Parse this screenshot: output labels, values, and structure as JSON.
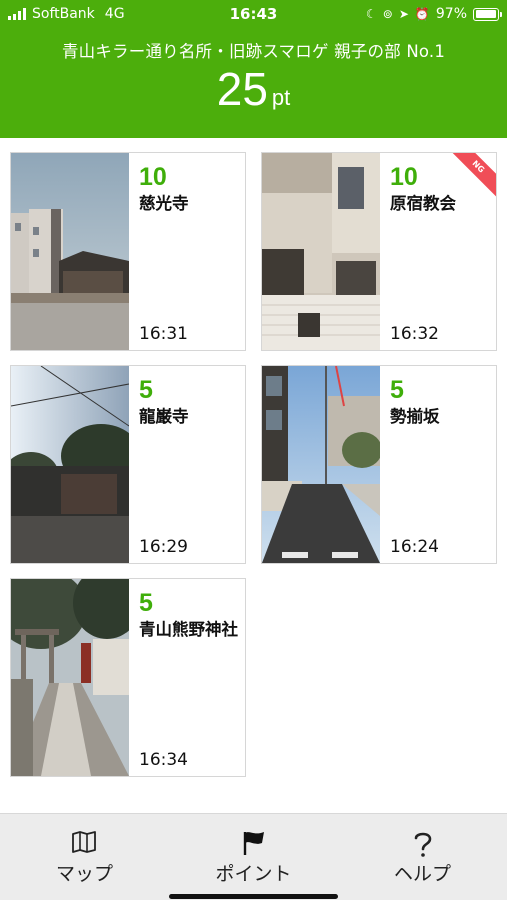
{
  "status_bar": {
    "carrier": "SoftBank",
    "network": "4G",
    "time": "16:43",
    "battery": "97%",
    "battery_level": 0.97,
    "icons": [
      "moon-icon",
      "rotation-lock-icon",
      "location-arrow-icon",
      "alarm-icon"
    ]
  },
  "header": {
    "title": "青山キラー通り名所・旧跡スマロゲ 親子の部 No.1",
    "score": "25",
    "score_unit": "pt",
    "background": "#4cae0c"
  },
  "cards": [
    {
      "points": "10",
      "name": "慈光寺",
      "time": "16:31",
      "ng": ""
    },
    {
      "points": "10",
      "name": "原宿教会",
      "time": "16:32",
      "ng": "NG"
    },
    {
      "points": "5",
      "name": "龍巌寺",
      "time": "16:29",
      "ng": ""
    },
    {
      "points": "5",
      "name": "勢揃坂",
      "time": "16:24",
      "ng": ""
    },
    {
      "points": "5",
      "name": "青山熊野神社",
      "time": "16:34",
      "ng": ""
    }
  ],
  "points_color": "#3fae0a",
  "ng_color": "#f04d57",
  "tabs": [
    {
      "label": "マップ",
      "icon": "map-icon"
    },
    {
      "label": "ポイント",
      "icon": "flag-icon"
    },
    {
      "label": "ヘルプ",
      "icon": "question-icon"
    }
  ]
}
